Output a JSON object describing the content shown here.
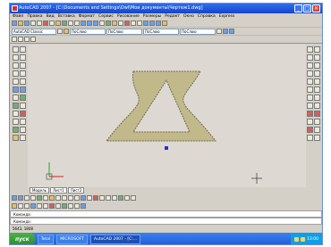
{
  "window": {
    "title": "AutoCAD 2007 - [C:\\Documents and Settings\\Owl\\Мои документы\\Чертеж1.dwg]",
    "close_glyph": "✕",
    "min_glyph": "_",
    "max_glyph": "□"
  },
  "menu": [
    "Файл",
    "Правка",
    "Вид",
    "Вставка",
    "Формат",
    "Сервис",
    "Рисование",
    "Размеры",
    "Редакт",
    "Окно",
    "Справка",
    "Express"
  ],
  "toolbar": {
    "workspace_combo": "AutoCAD Classic",
    "layer_combo": "ПоСлою",
    "linetype_combo": "ПоСлою",
    "lineweight_combo": "ПоСлою",
    "color_combo": "ПоСлою"
  },
  "tabs": [
    "Модель",
    "Лист1",
    "Лист2"
  ],
  "command_lines": [
    "Команда:",
    "Команда:"
  ],
  "status": "5643, 1808",
  "taskbar": {
    "start_label": "пуск",
    "items": [
      "Total",
      "MICROSOFT",
      "AutoCAD 2007 - [C:..."
    ],
    "clock": "13:00"
  },
  "colors": {
    "shape_fill": "#c2b98a",
    "shape_stroke": "#6f6a55",
    "grip": "#2a2adf"
  },
  "icons": [
    "line-icon",
    "circle-icon",
    "arc-icon",
    "rectangle-icon",
    "erase-icon",
    "move-icon",
    "copy-icon",
    "rotate-icon",
    "zoom-icon",
    "pan-icon"
  ]
}
